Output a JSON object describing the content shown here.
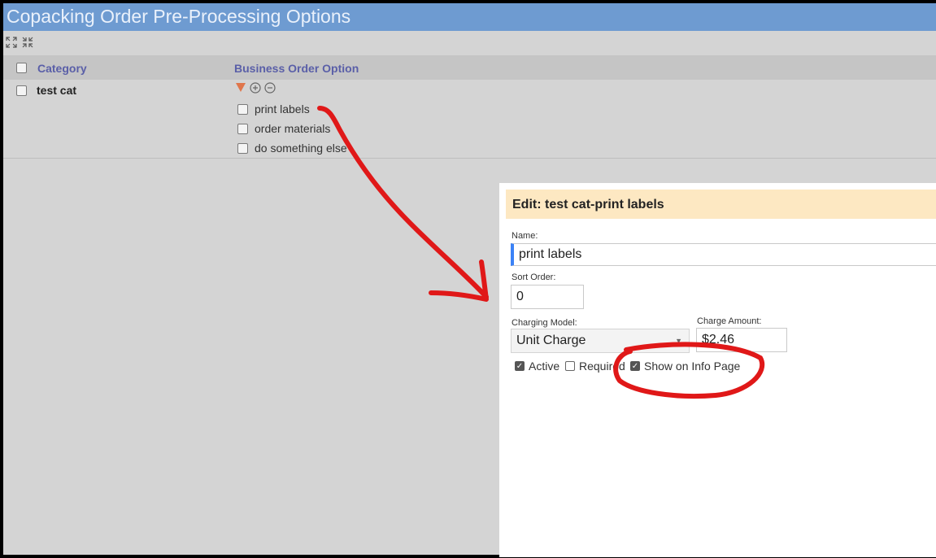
{
  "window": {
    "title": "Copacking Order Pre-Processing Options"
  },
  "toolbar": {
    "expand_icon": "expand-all-icon",
    "collapse_icon": "collapse-all-icon"
  },
  "grid": {
    "columns": {
      "category": "Category",
      "business_order_option": "Business Order Option"
    },
    "rows": [
      {
        "category": "test cat",
        "options": [
          "print labels",
          "order materials",
          "do something else"
        ]
      }
    ]
  },
  "edit_dialog": {
    "title": "Edit: test cat-print labels",
    "name_label": "Name:",
    "name_value": "print labels",
    "sort_order_label": "Sort Order:",
    "sort_order_value": "0",
    "charging_model_label": "Charging Model:",
    "charging_model_value": "Unit Charge",
    "charge_amount_label": "Charge Amount:",
    "charge_amount_value": "$2.46",
    "active_label": "Active",
    "active_checked": true,
    "required_label": "Required",
    "required_checked": false,
    "show_info_label": "Show on Info Page",
    "show_info_checked": true
  },
  "colors": {
    "title_bar": "#6e9bd1",
    "header_text": "#5a5fa8",
    "dialog_header": "#fde8c2",
    "annotation": "#e01818",
    "tree_toggle": "#e0764b"
  }
}
